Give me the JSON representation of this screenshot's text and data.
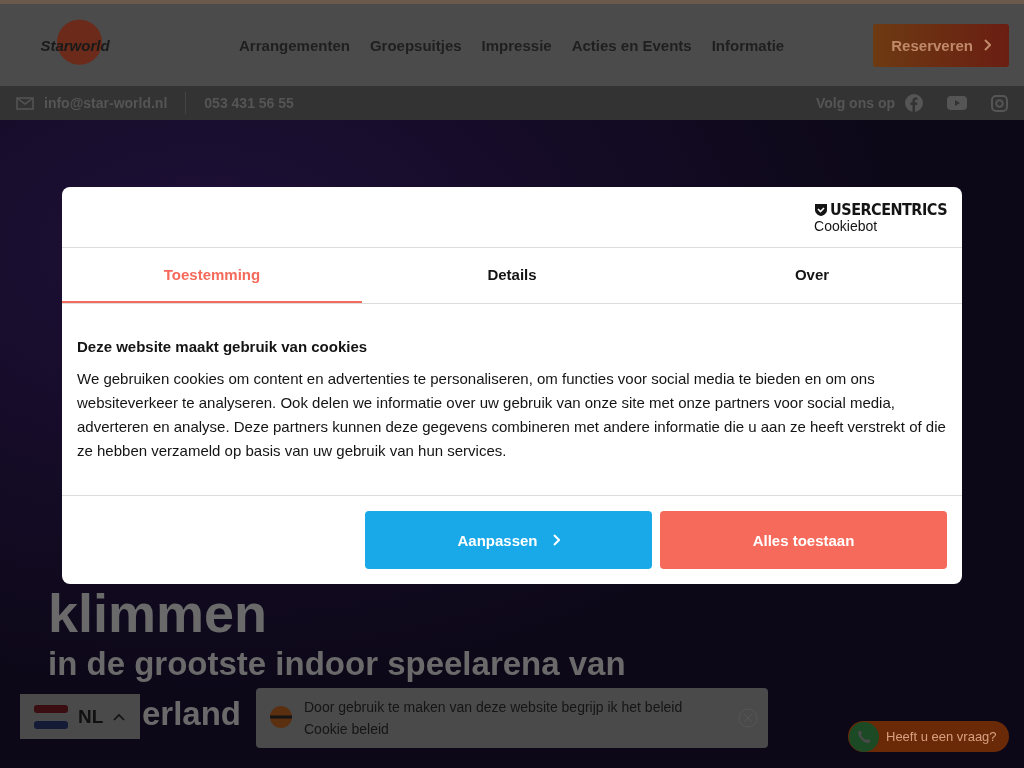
{
  "header": {
    "logo": "Starworld",
    "nav": [
      "Arrangementen",
      "Groepsuitjes",
      "Impressie",
      "Acties en Events",
      "Informatie"
    ],
    "cta": "Reserveren"
  },
  "topbar": {
    "email": "info@star-world.nl",
    "phone": "053 431 56 55",
    "follow": "Volg ons op"
  },
  "hero": {
    "lines": [
      "klimmen",
      "in de grootste indoor speelarena van",
      "erland"
    ]
  },
  "consent": {
    "brand": "USERCENTRICS",
    "product": "Cookiebot",
    "tabs": [
      {
        "label": "Toestemming",
        "selected": true
      },
      {
        "label": "Details",
        "selected": false
      },
      {
        "label": "Over",
        "selected": false
      }
    ],
    "heading": "Deze website maakt gebruik van cookies",
    "body": "We gebruiken cookies om content en advertenties te personaliseren, om functies voor social media te bieden en om ons websiteverkeer te analyseren. Ook delen we informatie over uw gebruik van onze site met onze partners voor social media, adverteren en analyse. Deze partners kunnen deze gegevens combineren met andere informatie die u aan ze heeft verstrekt of die ze hebben verzameld op basis van uw gebruik van hun services.",
    "buttons": [
      {
        "label": "Aanpassen",
        "kind": "secondary"
      },
      {
        "label": "Alles toestaan",
        "kind": "primary"
      }
    ]
  },
  "language": {
    "code": "NL"
  },
  "notice": {
    "text": "Door gebruik te maken van deze website begrijp ik het beleid",
    "link": "Cookie beleid"
  },
  "chat": {
    "label": "Heeft u een vraag?"
  }
}
